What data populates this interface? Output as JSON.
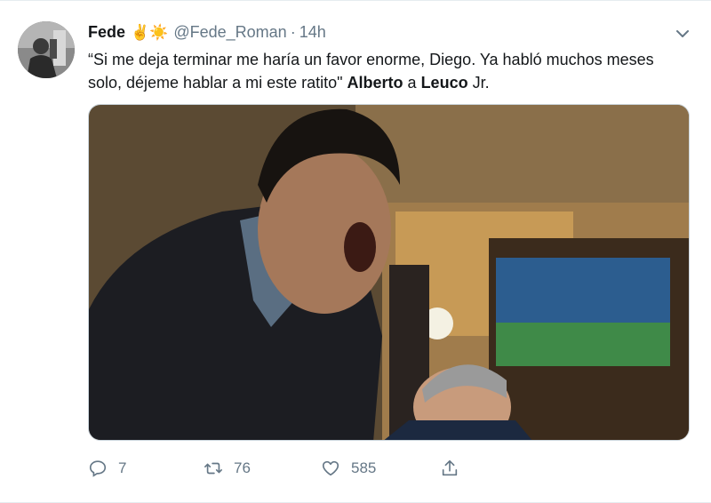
{
  "tweet": {
    "display_name": "Fede",
    "emojis": "✌️☀️",
    "handle": "@Fede_Roman",
    "separator": "·",
    "time": "14h",
    "text_part1": "“Si me deja terminar me haría un favor enorme, Diego. Ya habló muchos meses solo, déjeme hablar a mi este ratito\" ",
    "text_bold1": "Alberto",
    "text_mid": " a ",
    "text_bold2": "Leuco",
    "text_end": " Jr."
  },
  "actions": {
    "replies": "7",
    "retweets": "76",
    "likes": "585"
  },
  "icons": {
    "menu": "chevron-down-icon",
    "reply": "reply-icon",
    "retweet": "retweet-icon",
    "like": "heart-icon",
    "share": "share-icon"
  },
  "colors": {
    "text": "#14171a",
    "muted": "#657786",
    "border": "#e6ecf0"
  }
}
